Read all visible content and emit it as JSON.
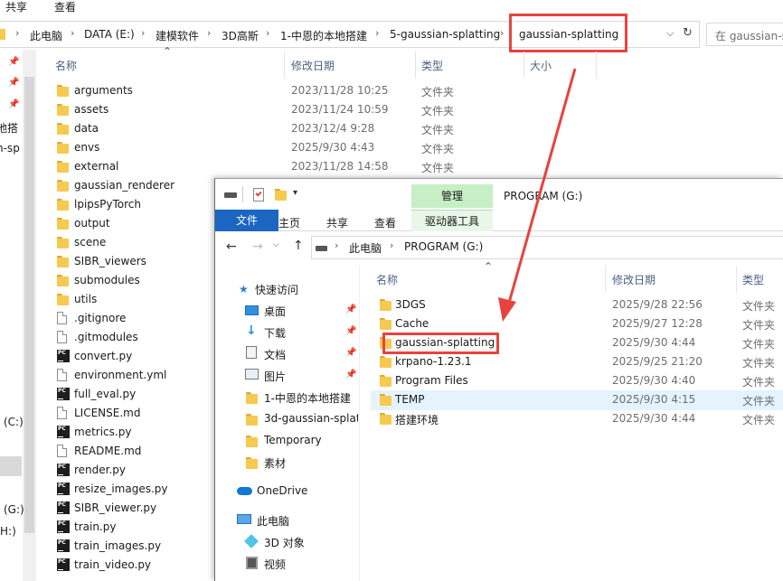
{
  "back_window": {
    "menu": {
      "share": "共享",
      "view": "查看"
    },
    "breadcrumb": [
      "此电脑",
      "DATA (E:)",
      "建模软件",
      "3D高斯",
      "1-中恩的本地搭建",
      "5-gaussian-splatting",
      "gaussian-splatting"
    ],
    "search_placeholder": "在 gaussian-s",
    "nav_partial": [
      "地搭",
      "n-sp",
      "(C:)",
      "(G:)",
      "H:)"
    ],
    "columns": {
      "name": "名称",
      "date": "修改日期",
      "type": "类型",
      "size": "大小"
    },
    "files": [
      {
        "icon": "folder-icon",
        "name": "arguments",
        "date": "2023/11/28 10:25",
        "type": "文件夹"
      },
      {
        "icon": "folder-icon",
        "name": "assets",
        "date": "2023/11/24 10:59",
        "type": "文件夹"
      },
      {
        "icon": "folder-icon",
        "name": "data",
        "date": "2023/12/4 9:28",
        "type": "文件夹"
      },
      {
        "icon": "folder-icon",
        "name": "envs",
        "date": "2025/9/30 4:43",
        "type": "文件夹"
      },
      {
        "icon": "folder-icon",
        "name": "external",
        "date": "2023/11/28 14:58",
        "type": "文件夹"
      },
      {
        "icon": "folder-icon",
        "name": "gaussian_renderer",
        "date": "",
        "type": ""
      },
      {
        "icon": "folder-icon",
        "name": "lpipsPyTorch",
        "date": "",
        "type": ""
      },
      {
        "icon": "folder-icon",
        "name": "output",
        "date": "",
        "type": ""
      },
      {
        "icon": "folder-icon",
        "name": "scene",
        "date": "",
        "type": ""
      },
      {
        "icon": "folder-icon",
        "name": "SIBR_viewers",
        "date": "",
        "type": ""
      },
      {
        "icon": "folder-icon",
        "name": "submodules",
        "date": "",
        "type": ""
      },
      {
        "icon": "folder-icon",
        "name": "utils",
        "date": "",
        "type": ""
      },
      {
        "icon": "doc-icon",
        "name": ".gitignore",
        "date": "",
        "type": ""
      },
      {
        "icon": "doc-icon",
        "name": ".gitmodules",
        "date": "",
        "type": ""
      },
      {
        "icon": "python-file-icon",
        "name": "convert.py",
        "date": "",
        "type": ""
      },
      {
        "icon": "doc-icon",
        "name": "environment.yml",
        "date": "",
        "type": ""
      },
      {
        "icon": "python-file-icon",
        "name": "full_eval.py",
        "date": "",
        "type": ""
      },
      {
        "icon": "doc-icon",
        "name": "LICENSE.md",
        "date": "",
        "type": ""
      },
      {
        "icon": "python-file-icon",
        "name": "metrics.py",
        "date": "",
        "type": ""
      },
      {
        "icon": "doc-icon",
        "name": "README.md",
        "date": "",
        "type": ""
      },
      {
        "icon": "python-file-icon",
        "name": "render.py",
        "date": "",
        "type": ""
      },
      {
        "icon": "python-file-icon",
        "name": "resize_images.py",
        "date": "",
        "type": ""
      },
      {
        "icon": "python-file-icon",
        "name": "SIBR_viewer.py",
        "date": "",
        "type": ""
      },
      {
        "icon": "python-file-icon",
        "name": "train.py",
        "date": "",
        "type": ""
      },
      {
        "icon": "python-file-icon",
        "name": "train_images.py",
        "date": "",
        "type": ""
      },
      {
        "icon": "python-file-icon",
        "name": "train_video.py",
        "date": "",
        "type": ""
      }
    ]
  },
  "front_window": {
    "title": "PROGRAM (G:)",
    "manage_tab": "管理",
    "drive_tools_tab": "驱动器工具",
    "ribbon_tabs": {
      "file": "文件",
      "home": "主页",
      "share": "共享",
      "view": "查看"
    },
    "breadcrumb": [
      "此电脑",
      "PROGRAM (G:)"
    ],
    "columns": {
      "name": "名称",
      "date": "修改日期",
      "type": "类型"
    },
    "nav": {
      "quick_access": "快速访问",
      "quick_items": [
        "桌面",
        "下载",
        "文档",
        "图片",
        "1-中恩的本地搭建",
        "3d-gaussian-splat",
        "Temporary",
        "素材"
      ],
      "onedrive": "OneDrive",
      "this_pc": "此电脑",
      "pc_items": [
        "3D 对象",
        "视频"
      ]
    },
    "files": [
      {
        "name": "3DGS",
        "date": "2025/9/28 22:56",
        "type": "文件夹"
      },
      {
        "name": "Cache",
        "date": "2025/9/27 12:28",
        "type": "文件夹"
      },
      {
        "name": "gaussian-splatting",
        "date": "2025/9/30 4:44",
        "type": "文件夹"
      },
      {
        "name": "krpano-1.23.1",
        "date": "2025/9/25 21:20",
        "type": "文件夹"
      },
      {
        "name": "Program Files",
        "date": "2025/9/30 4:40",
        "type": "文件夹"
      },
      {
        "name": "TEMP",
        "date": "2025/9/30 4:15",
        "type": "文件夹"
      },
      {
        "name": "搭建环境",
        "date": "2025/9/30 4:44",
        "type": "文件夹"
      }
    ]
  },
  "colors": {
    "highlight": "#e8423f",
    "file_tab": "#1a66c0",
    "manage_tab": "#c6efc6",
    "selected_row": "#e5f3ff"
  }
}
